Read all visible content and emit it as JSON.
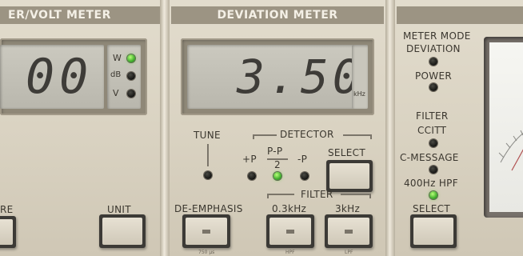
{
  "left_panel": {
    "title": "ER/VOLT METER",
    "lcd_value": "00",
    "units": [
      {
        "label": "W",
        "led_on": true
      },
      {
        "label": "dB",
        "led_on": false
      },
      {
        "label": "V",
        "led_on": false
      }
    ],
    "partial_button_label": "RE",
    "unit_button_label": "UNIT"
  },
  "deviation_panel": {
    "title": "DEVIATION METER",
    "lcd_value": "3.50",
    "lcd_unit": "kHz",
    "tune_label": "TUNE",
    "detector": {
      "label": "DETECTOR",
      "options": [
        {
          "label": "+P",
          "led_on": false
        },
        {
          "label": "P-P",
          "sub": "2",
          "led_on": true
        },
        {
          "label": "-P",
          "led_on": false
        }
      ],
      "select_label": "SELECT"
    },
    "filter_label": "FILTER",
    "buttons": [
      {
        "label": "DE-EMPHASIS",
        "sub": "750 μs"
      },
      {
        "label": "0.3kHz",
        "sub": "HPF"
      },
      {
        "label": "3kHz",
        "sub": "LPF"
      }
    ]
  },
  "right_panel": {
    "meter_mode_label": "METER MODE",
    "modes": [
      {
        "label": "DEVIATION",
        "led_on": false
      },
      {
        "label": "POWER",
        "led_on": false
      }
    ],
    "filter_label": "FILTER",
    "filters": [
      {
        "label": "CCITT",
        "led_on": false
      },
      {
        "label": "C-MESSAGE",
        "led_on": false
      },
      {
        "label": "400Hz  HPF",
        "led_on": true
      }
    ],
    "select_label": "SELECT"
  },
  "colors": {
    "panel": "#d9d2c1",
    "title_bar": "#9c9483",
    "lcd": "#c3c1b7",
    "led_on": "#3fae2c",
    "button_frame": "#3c3a36"
  }
}
